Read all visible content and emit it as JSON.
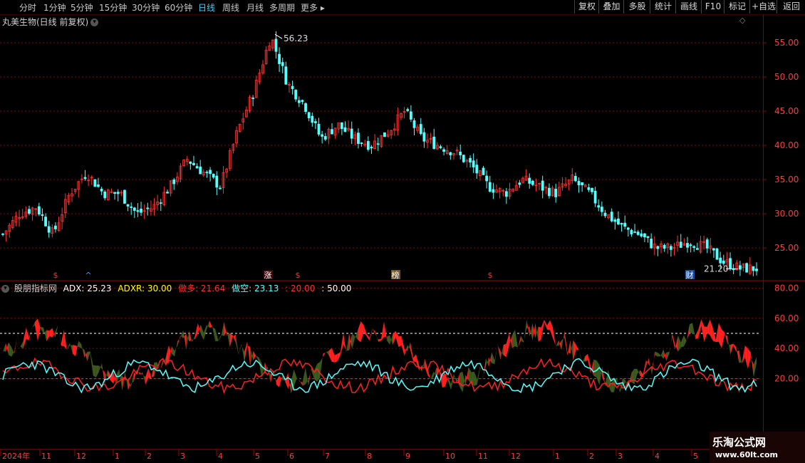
{
  "toolbar": {
    "periods": [
      "分时",
      "1分钟",
      "5分钟",
      "15分钟",
      "30分钟",
      "60分钟",
      "日线",
      "周线",
      "月线",
      "多周期",
      "更多"
    ],
    "active_period": "日线",
    "right_buttons": [
      "复权",
      "叠加",
      "多股",
      "统计",
      "画线",
      "F10",
      "标记",
      "+自选",
      "返回"
    ]
  },
  "stock": {
    "title": "丸美生物(日线 前复权)"
  },
  "price_axis": {
    "ticks": [
      "55.00",
      "50.00",
      "45.00",
      "40.00",
      "35.00",
      "30.00",
      "25.00"
    ]
  },
  "annotations": {
    "high": "56.23",
    "low": "21.20"
  },
  "event_markers": [
    "$",
    "^",
    "涨",
    "$",
    "榜",
    "$",
    "财"
  ],
  "indicator": {
    "name": "股朋指标网",
    "adx_label": "ADX: 25.23",
    "adxr_label": "ADXR: 30.00",
    "long_label": "做多: 21.64",
    "short_label": "做空: 23.13",
    "level20_label": ": 20.00",
    "level50_label": ": 50.00",
    "axis_ticks": [
      "80.00",
      "60.00",
      "40.00",
      "20.00"
    ]
  },
  "date_axis": {
    "labels": [
      "2024年",
      "11",
      "12",
      "1",
      "2",
      "3",
      "4",
      "5",
      "6",
      "7",
      "8",
      "9",
      "10",
      "11",
      "12",
      "1",
      "2",
      "3",
      "4",
      "5"
    ]
  },
  "watermark": {
    "line1": "乐淘公式网",
    "line2": "www.60lt.com"
  },
  "colors": {
    "up": "#ff3232",
    "down": "#54ffff",
    "adx": "#ffffff",
    "long": "#ff2020",
    "short": "#54ffff",
    "green_band": "#3d5a1e",
    "grid": "#8a0000"
  },
  "chart_data": [
    {
      "type": "candlestick",
      "title": "丸美生物(日线 前复权)",
      "ylim": [
        21,
        58
      ],
      "x": [
        "2024-10",
        "2024-11",
        "2024-12",
        "2025-01",
        "2025-02",
        "2025-03",
        "2025-04",
        "2025-05",
        "2025-06",
        "2025-07",
        "2025-08",
        "2025-09",
        "2025-10",
        "2025-11",
        "2025-12",
        "2026-01",
        "2026-02",
        "2026-03",
        "2026-04",
        "2026-05"
      ],
      "close_path": [
        27,
        30,
        31,
        27,
        33,
        36,
        33,
        33,
        30,
        31,
        34,
        38,
        36,
        34,
        42,
        48,
        56,
        49,
        46,
        41,
        43,
        41,
        40,
        42,
        45,
        41,
        40,
        39,
        37,
        34,
        33,
        35,
        34,
        33,
        35,
        33,
        30,
        28,
        27,
        25,
        25,
        26,
        25,
        23,
        22,
        22
      ],
      "high": 56.23,
      "low": 21.2
    },
    {
      "type": "line",
      "title": "股朋指标网",
      "ylim": [
        0,
        90
      ],
      "series": [
        {
          "name": "ADX",
          "last": 25.23
        },
        {
          "name": "ADXR",
          "last": 30.0
        },
        {
          "name": "做多",
          "last": 21.64
        },
        {
          "name": "做空",
          "last": 23.13
        }
      ],
      "reference_lines": [
        20,
        50
      ]
    }
  ]
}
